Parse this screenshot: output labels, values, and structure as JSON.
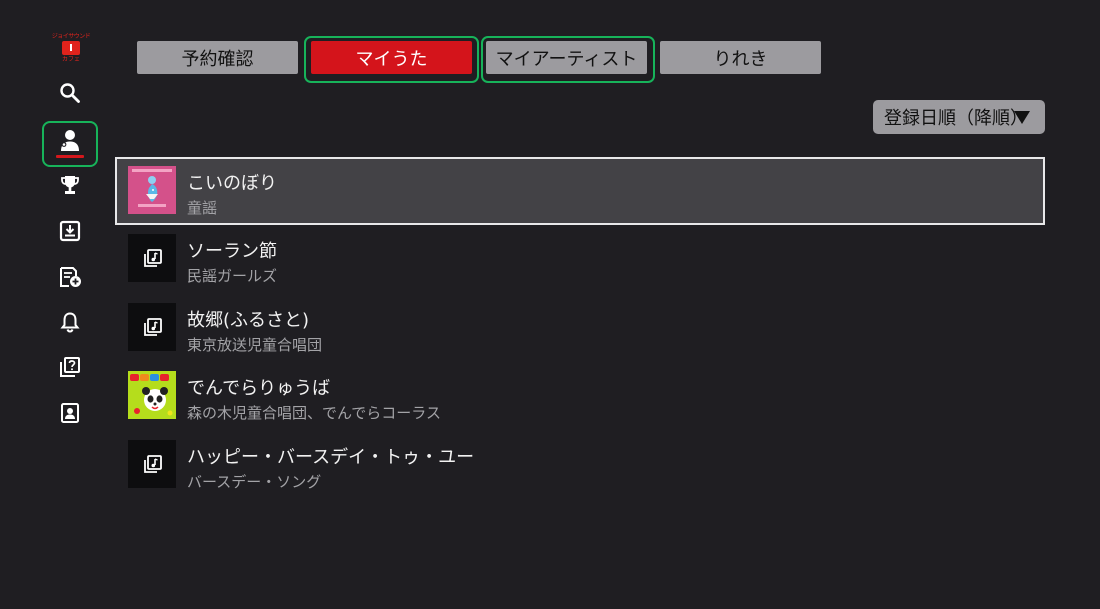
{
  "app": {
    "logo_top": "ジョイサウンド",
    "logo_bottom": "カフェ"
  },
  "sidebar": {
    "items": [
      {
        "name": "search",
        "icon": "search-icon",
        "active": false
      },
      {
        "name": "my-page",
        "icon": "person-icon",
        "active": true
      },
      {
        "name": "ranking",
        "icon": "trophy-icon",
        "active": false
      },
      {
        "name": "downloads",
        "icon": "download-box-icon",
        "active": false
      },
      {
        "name": "playlist-add",
        "icon": "playlist-add-icon",
        "active": false
      },
      {
        "name": "notifications",
        "icon": "bell-icon",
        "active": false
      },
      {
        "name": "help",
        "icon": "help-icon",
        "active": false
      },
      {
        "name": "account",
        "icon": "account-card-icon",
        "active": false
      }
    ]
  },
  "tabs": [
    {
      "label": "予約確認",
      "selected": false
    },
    {
      "label": "マイうた",
      "selected": true
    },
    {
      "label": "マイアーティスト",
      "selected": false
    },
    {
      "label": "りれき",
      "selected": false
    }
  ],
  "sort": {
    "label": "登録日順（降順）"
  },
  "songs": [
    {
      "title": "こいのぼり",
      "artist": "童謡",
      "thumb": "album-art-pink",
      "focused": true
    },
    {
      "title": "ソーラン節",
      "artist": "民謡ガールズ",
      "thumb": "music-note-icon",
      "focused": false
    },
    {
      "title": "故郷(ふるさと)",
      "artist": "東京放送児童合唱団",
      "thumb": "music-note-icon",
      "focused": false
    },
    {
      "title": "でんでらりゅうば",
      "artist": "森の木児童合唱団、でんでらコーラス",
      "thumb": "album-art-green",
      "focused": false
    },
    {
      "title": "ハッピー・バースデイ・トゥ・ユー",
      "artist": "バースデー・ソング",
      "thumb": "music-note-icon",
      "focused": false
    }
  ],
  "colors": {
    "background": "#1f1e22",
    "accent_red": "#d4141b",
    "focus_green": "#17b35a",
    "tab_gray": "#9c9b9f"
  }
}
